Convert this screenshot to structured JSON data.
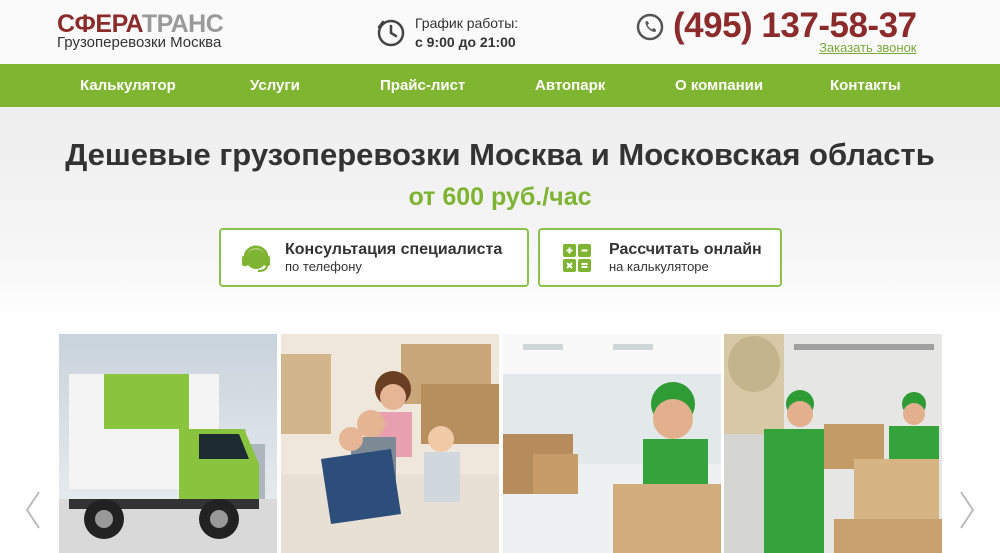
{
  "header": {
    "logo_part1": "СФЕРА",
    "logo_part2": "ТРАНС",
    "logo_sub": "Грузоперевозки Москва",
    "schedule_label": "График работы:",
    "schedule_hours": "с 9:00 до 21:00",
    "phone": "(495) 137-58-37",
    "callback_link": "Заказать звонок"
  },
  "nav": {
    "items": [
      "Калькулятор",
      "Услуги",
      "Прайс-лист",
      "Автопарк",
      "О компании",
      "Контакты"
    ]
  },
  "hero": {
    "title": "Дешевые грузоперевозки Москва и Московская область",
    "price": "от 600 руб./час",
    "buttons": [
      {
        "title": "Консультация специалиста",
        "sub": "по телефону"
      },
      {
        "title": "Рассчитать онлайн",
        "sub": "на калькуляторе"
      }
    ]
  },
  "colors": {
    "brand_red": "#8b2b2b",
    "accent_green": "#80b531"
  }
}
